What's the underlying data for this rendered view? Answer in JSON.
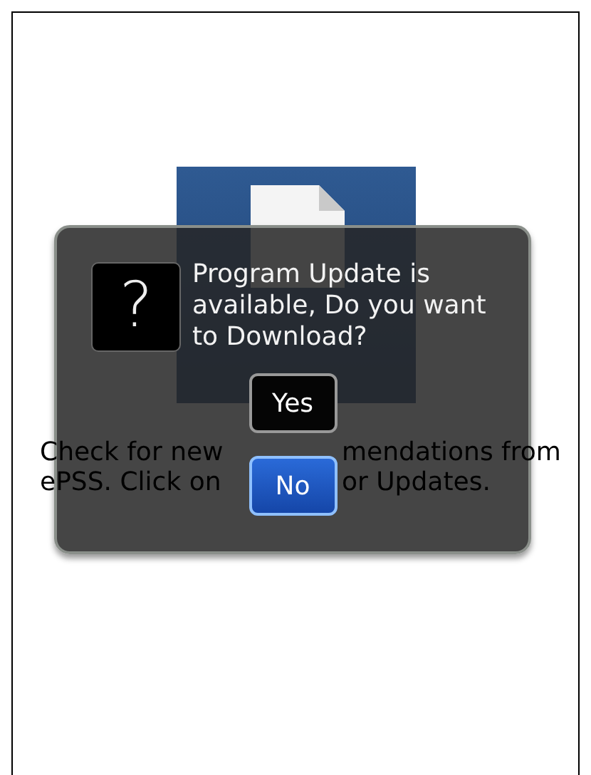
{
  "description_lines": [
    [
      "Check for new",
      "mendations from"
    ],
    [
      "ePSS. Click on",
      "or Updates."
    ]
  ],
  "dialog": {
    "icon_glyph": "?",
    "message": "Program Update is available, Do you want to Download?",
    "buttons": [
      {
        "label": "Yes",
        "selected": false
      },
      {
        "label": "No",
        "selected": true
      }
    ]
  }
}
